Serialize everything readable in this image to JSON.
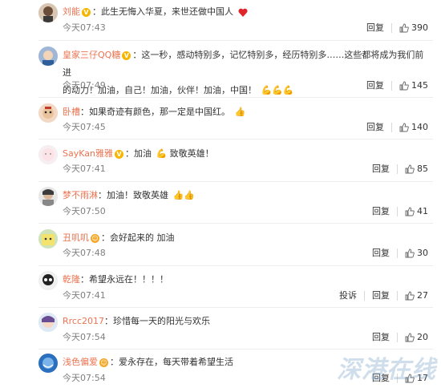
{
  "comments": [
    {
      "user": "刘能",
      "text": "此生无悔入华夏，来世还做中国人",
      "time": "今天07:43",
      "reply": "回复",
      "likes": "390"
    },
    {
      "user": "皇家三仔QQ糖",
      "text": "这一秒，感动特别多，记忆特别多，经历特别多……这些都将成为我们前进",
      "text2": "的动力！加油，自己！加油，伙伴！加油，中国！",
      "time": "今天07:49",
      "reply": "回复",
      "likes": "145"
    },
    {
      "user": "卧槽",
      "text": "如果奇迹有颜色，那一定是中国红。",
      "time": "今天07:45",
      "reply": "回复",
      "likes": "140"
    },
    {
      "user": "SayKan雅雅",
      "text": "加油",
      "text_b": "致敬英雄！",
      "time": "今天07:41",
      "reply": "回复",
      "likes": "85"
    },
    {
      "user": "梦不雨淋",
      "text": "加油！致敬英雄",
      "time": "今天07:50",
      "reply": "回复",
      "likes": "41"
    },
    {
      "user": "丑叽叽",
      "text": "会好起来的 加油",
      "time": "今天07:48",
      "reply": "回复",
      "likes": "30"
    },
    {
      "user": "乾隆",
      "text": "希望永远在！！！！",
      "time": "今天07:41",
      "report": "投诉",
      "reply": "回复",
      "likes": "27"
    },
    {
      "user": "Rrcc2017",
      "text": "珍惜每一天的阳光与欢乐",
      "time": "今天07:54",
      "reply": "回复",
      "likes": "20"
    },
    {
      "user": "浅色偏爱",
      "text": "爱永存在，每天带着希望生活",
      "time": "今天07:54",
      "reply": "回复",
      "likes": "17"
    }
  ],
  "colors": {
    "username": "#eb7350",
    "text": "#333333",
    "meta": "#808080"
  },
  "icons": {
    "like": "thumbs-up-icon",
    "badge": "vip-badge-icon"
  },
  "watermark": "深港在线"
}
